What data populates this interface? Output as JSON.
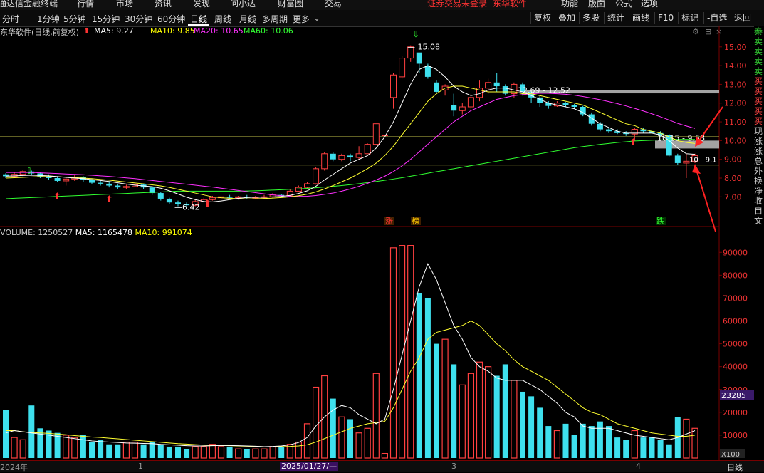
{
  "app": {
    "title_left": "通达信金融终端",
    "top_menu": [
      "行情",
      "市场",
      "资讯",
      "发现",
      "问小达",
      "财富圈",
      "交易"
    ],
    "top_menu_right": [
      "功能",
      "版面",
      "公式",
      "选项"
    ],
    "notice": "证券交易未登录",
    "notice_stock": "东华软件"
  },
  "tabs": [
    "分时",
    "1分钟",
    "5分钟",
    "15分钟",
    "30分钟",
    "60分钟",
    "日线",
    "周线",
    "月线",
    "多周期",
    "更多"
  ],
  "active_tab": "日线",
  "tools": [
    "复权",
    "叠加",
    "多股",
    "统计",
    "画线",
    "F10",
    "标记",
    "-自选",
    "返回"
  ],
  "stock": {
    "title": "东华软件(日线,前复权)",
    "ma5": "MA5: 9.27",
    "ma10": "MA10: 9.85",
    "ma20": "MA20: 10.65",
    "ma60": "MA60: 10.06"
  },
  "volume_info": {
    "volume": "VOLUME: 1250527",
    "ma5": "MA5: 1165478",
    "ma10": "MA10: 991074"
  },
  "annotations": {
    "high": "15.08",
    "low": "6.42",
    "zone1": "12.69 - 12.52",
    "zone2": "10.15 - 9.58",
    "zone3": "10 - 9.1",
    "zhang": "涨",
    "bang": "榜",
    "die": "跌",
    "vol_current": "23285",
    "vol_scale": "X100"
  },
  "colors": {
    "up": "#ff4040",
    "down": "#3ee0ee",
    "ma5": "#ffffff",
    "ma10": "#ffff30",
    "ma20": "#ff30ff",
    "ma60": "#30ff30",
    "grid": "#7a0000",
    "zone": "#c0c0c0"
  },
  "sidebar_text": [
    "秦",
    "卖",
    "卖",
    "卖",
    "卖",
    "买",
    "买",
    "买",
    "买",
    "买",
    "现",
    "涨",
    "涨",
    "总",
    "外",
    "换",
    "净",
    "收",
    "自",
    "文"
  ],
  "bottom": {
    "year_label": "2024年",
    "m1": "1",
    "date_label": "2025/01/27/—",
    "m3": "3",
    "m4": "4",
    "period": "日线"
  },
  "chart_data": {
    "type": "candlestick",
    "y_ticks": [
      15.0,
      14.0,
      13.0,
      12.0,
      11.0,
      10.0,
      9.0,
      8.0,
      7.0
    ],
    "ylim": [
      6.1,
      15.6
    ],
    "vol_ticks": [
      90000,
      80000,
      70000,
      60000,
      50000,
      40000,
      30000,
      20000,
      10000
    ],
    "vol_ylim": [
      0,
      96000
    ],
    "hlines": [
      10.2,
      8.7
    ],
    "candles": [
      [
        8.2,
        8.1,
        8.25,
        8.0
      ],
      [
        8.1,
        8.2,
        8.3,
        8.05
      ],
      [
        8.2,
        8.35,
        8.45,
        8.1
      ],
      [
        8.35,
        8.25,
        8.4,
        8.15
      ],
      [
        8.25,
        8.1,
        8.3,
        8.0
      ],
      [
        8.1,
        8.0,
        8.2,
        7.9
      ],
      [
        8.0,
        7.85,
        8.1,
        7.8
      ],
      [
        7.85,
        7.95,
        8.05,
        7.6
      ],
      [
        7.95,
        8.05,
        8.15,
        7.85
      ],
      [
        8.05,
        7.9,
        8.1,
        7.8
      ],
      [
        7.9,
        7.75,
        7.95,
        7.7
      ],
      [
        7.75,
        7.7,
        7.85,
        7.6
      ],
      [
        7.7,
        7.6,
        7.8,
        7.5
      ],
      [
        7.6,
        7.5,
        7.7,
        7.4
      ],
      [
        7.5,
        7.55,
        7.65,
        7.4
      ],
      [
        7.55,
        7.65,
        7.75,
        7.45
      ],
      [
        7.65,
        7.5,
        7.7,
        7.4
      ],
      [
        7.5,
        7.2,
        7.55,
        7.1
      ],
      [
        7.2,
        6.9,
        7.25,
        6.8
      ],
      [
        6.9,
        6.7,
        6.95,
        6.6
      ],
      [
        6.7,
        6.6,
        6.8,
        6.5
      ],
      [
        6.6,
        6.55,
        6.7,
        6.42
      ],
      [
        6.55,
        6.75,
        6.85,
        6.5
      ],
      [
        6.75,
        6.85,
        6.95,
        6.7
      ],
      [
        6.85,
        6.95,
        7.05,
        6.8
      ],
      [
        6.95,
        7.0,
        7.1,
        6.9
      ],
      [
        7.0,
        6.95,
        7.1,
        6.9
      ],
      [
        6.95,
        7.0,
        7.05,
        6.85
      ],
      [
        7.0,
        6.95,
        7.1,
        6.9
      ],
      [
        6.95,
        6.98,
        7.05,
        6.9
      ],
      [
        6.98,
        7.0,
        7.1,
        6.9
      ],
      [
        7.0,
        7.1,
        7.2,
        6.95
      ],
      [
        7.1,
        7.05,
        7.15,
        7.0
      ],
      [
        7.05,
        7.3,
        7.4,
        7.0
      ],
      [
        7.3,
        7.5,
        7.6,
        7.25
      ],
      [
        7.5,
        7.7,
        7.8,
        7.45
      ],
      [
        7.7,
        8.5,
        8.6,
        7.65
      ],
      [
        8.5,
        9.3,
        9.4,
        8.4
      ],
      [
        9.3,
        9.0,
        9.4,
        8.9
      ],
      [
        9.0,
        9.2,
        9.3,
        8.9
      ],
      [
        9.2,
        9.1,
        9.3,
        8.9
      ],
      [
        9.1,
        9.3,
        9.7,
        9.0
      ],
      [
        9.3,
        9.8,
        9.85,
        9.3
      ],
      [
        9.8,
        10.9,
        10.9,
        9.8
      ],
      [
        10.3,
        10.3,
        10.3,
        10.3
      ],
      [
        12.3,
        13.5,
        13.6,
        11.7
      ],
      [
        13.4,
        14.4,
        14.5,
        13.3
      ],
      [
        14.4,
        15.0,
        15.08,
        14.2
      ],
      [
        14.7,
        14.1,
        14.5,
        13.6
      ],
      [
        14.0,
        13.4,
        14.1,
        13.3
      ],
      [
        13.1,
        12.6,
        13.2,
        12.5
      ],
      [
        12.7,
        12.9,
        13.0,
        12.4
      ],
      [
        11.9,
        11.6,
        12.5,
        11.3
      ],
      [
        11.6,
        11.8,
        12.0,
        11.4
      ],
      [
        11.8,
        12.3,
        12.5,
        11.6
      ],
      [
        12.3,
        12.8,
        13.2,
        12.1
      ],
      [
        12.8,
        13.1,
        13.3,
        12.5
      ],
      [
        13.1,
        12.9,
        13.6,
        12.6
      ],
      [
        12.9,
        12.5,
        13.0,
        12.4
      ],
      [
        12.5,
        13.0,
        13.1,
        12.3
      ],
      [
        13.0,
        12.6,
        13.1,
        12.4
      ],
      [
        12.6,
        12.3,
        12.7,
        12.0
      ],
      [
        12.3,
        12.0,
        12.4,
        11.8
      ],
      [
        12.0,
        11.85,
        12.1,
        11.7
      ],
      [
        11.85,
        12.0,
        12.1,
        11.8
      ],
      [
        12.0,
        11.9,
        12.05,
        11.8
      ],
      [
        11.9,
        11.8,
        11.95,
        11.7
      ],
      [
        11.8,
        11.4,
        11.85,
        11.3
      ],
      [
        11.4,
        10.9,
        11.5,
        10.8
      ],
      [
        10.9,
        10.6,
        11.0,
        10.5
      ],
      [
        10.6,
        10.5,
        10.7,
        10.4
      ],
      [
        10.5,
        10.4,
        10.6,
        10.35
      ],
      [
        10.4,
        10.35,
        10.5,
        10.25
      ],
      [
        10.35,
        10.6,
        10.7,
        10.0
      ],
      [
        10.6,
        10.5,
        10.7,
        10.4
      ],
      [
        10.5,
        10.4,
        10.6,
        10.3
      ],
      [
        10.4,
        10.3,
        10.5,
        10.2
      ],
      [
        10.3,
        9.2,
        10.35,
        9.15
      ],
      [
        9.2,
        8.8,
        9.3,
        8.7
      ],
      [
        8.8,
        8.9,
        9.3,
        8.0
      ],
      [
        8.9,
        9.2,
        9.3,
        8.8
      ]
    ],
    "volumes": [
      21000,
      9000,
      8000,
      23000,
      13000,
      12000,
      11000,
      10000,
      9000,
      10000,
      7000,
      8000,
      6000,
      6000,
      7000,
      7000,
      6000,
      7000,
      6000,
      5000,
      5000,
      4000,
      5000,
      5000,
      6000,
      5000,
      5000,
      4000,
      4000,
      4000,
      4000,
      5000,
      5000,
      6000,
      7000,
      15000,
      31000,
      36000,
      26000,
      18000,
      17000,
      11000,
      13000,
      37000,
      2000,
      92000,
      93000,
      93000,
      72000,
      70000,
      50000,
      52000,
      41000,
      32000,
      37000,
      42000,
      40000,
      36000,
      41000,
      34000,
      29000,
      27000,
      22000,
      14000,
      12000,
      15000,
      10000,
      15000,
      14000,
      16000,
      14000,
      9000,
      8000,
      12000,
      9000,
      9000,
      8000,
      6000,
      18000,
      17000,
      13000
    ],
    "vol_ma5": [
      11000,
      12000,
      11500,
      11000,
      10500,
      10000,
      9500,
      9000,
      8500,
      8000,
      7500,
      7200,
      7000,
      6800,
      6600,
      6500,
      6400,
      6300,
      6000,
      5800,
      5600,
      5400,
      5300,
      5300,
      5400,
      5500,
      5500,
      5400,
      5300,
      5200,
      5000,
      5100,
      5300,
      5800,
      6800,
      9000,
      14000,
      18000,
      21000,
      23000,
      22000,
      19000,
      17000,
      15000,
      17000,
      30000,
      45000,
      60000,
      75000,
      85000,
      78000,
      68000,
      58000,
      52000,
      44000,
      40000,
      38000,
      35000,
      34000,
      34000,
      34000,
      32000,
      30000,
      27000,
      24000,
      20000,
      18000,
      14000,
      13000,
      13000,
      13000,
      12000,
      11000,
      10000,
      9500,
      9000,
      8500,
      8000,
      9000,
      10500,
      12000
    ],
    "vol_ma10": [
      12000,
      12000,
      11500,
      11200,
      11000,
      10800,
      10500,
      10200,
      9800,
      9500,
      9200,
      9000,
      8700,
      8400,
      8100,
      7800,
      7500,
      7200,
      6900,
      6600,
      6300,
      6100,
      5900,
      5700,
      5600,
      5500,
      5400,
      5300,
      5200,
      5100,
      5000,
      5000,
      5000,
      5100,
      5300,
      5800,
      7000,
      8500,
      10000,
      11500,
      13000,
      14000,
      15000,
      15500,
      16000,
      22000,
      30000,
      38000,
      44000,
      52000,
      55000,
      56000,
      57000,
      58000,
      60000,
      58000,
      54000,
      50000,
      47000,
      43000,
      40000,
      38000,
      36000,
      34000,
      31000,
      28000,
      25000,
      22000,
      20000,
      19000,
      17000,
      15000,
      14000,
      13000,
      12000,
      11000,
      10500,
      10000,
      9500,
      9500,
      10000
    ],
    "ma5": [
      8.1,
      8.12,
      8.14,
      8.15,
      8.14,
      8.12,
      8.08,
      8.04,
      8.0,
      7.97,
      7.92,
      7.87,
      7.82,
      7.75,
      7.68,
      7.62,
      7.58,
      7.54,
      7.46,
      7.32,
      7.15,
      6.98,
      6.85,
      6.75,
      6.73,
      6.78,
      6.85,
      6.92,
      6.96,
      6.98,
      6.98,
      7.0,
      7.02,
      7.08,
      7.18,
      7.32,
      7.56,
      7.9,
      8.2,
      8.5,
      8.8,
      9.0,
      9.2,
      9.6,
      10.2,
      11.0,
      12.0,
      13.0,
      13.8,
      14.0,
      13.8,
      13.4,
      12.9,
      12.6,
      12.4,
      12.5,
      12.7,
      12.8,
      12.8,
      12.7,
      12.6,
      12.4,
      12.2,
      12.0,
      11.9,
      11.8,
      11.7,
      11.5,
      11.2,
      10.9,
      10.7,
      10.5,
      10.4,
      10.4,
      10.4,
      10.4,
      10.3,
      10.0,
      9.6,
      9.3,
      9.27
    ],
    "ma10": [
      8.0,
      8.02,
      8.04,
      8.06,
      8.08,
      8.08,
      8.07,
      8.05,
      8.03,
      8.0,
      7.97,
      7.93,
      7.89,
      7.84,
      7.79,
      7.74,
      7.69,
      7.64,
      7.58,
      7.5,
      7.4,
      7.3,
      7.2,
      7.1,
      7.0,
      6.95,
      6.92,
      6.9,
      6.89,
      6.9,
      6.91,
      6.93,
      6.96,
      7.0,
      7.06,
      7.14,
      7.26,
      7.42,
      7.6,
      7.8,
      8.0,
      8.25,
      8.5,
      8.8,
      9.2,
      9.7,
      10.3,
      10.9,
      11.5,
      12.1,
      12.5,
      12.8,
      12.9,
      12.9,
      12.8,
      12.7,
      12.6,
      12.6,
      12.6,
      12.6,
      12.5,
      12.5,
      12.4,
      12.3,
      12.2,
      12.1,
      12.0,
      11.9,
      11.7,
      11.5,
      11.3,
      11.1,
      10.9,
      10.8,
      10.6,
      10.5,
      10.4,
      10.2,
      10.0,
      9.9,
      9.85
    ],
    "ma20": [
      8.3,
      8.3,
      8.3,
      8.3,
      8.28,
      8.26,
      8.24,
      8.22,
      8.2,
      8.18,
      8.15,
      8.12,
      8.09,
      8.05,
      8.01,
      7.97,
      7.92,
      7.87,
      7.82,
      7.77,
      7.72,
      7.67,
      7.62,
      7.57,
      7.52,
      7.46,
      7.4,
      7.34,
      7.28,
      7.22,
      7.16,
      7.1,
      7.06,
      7.03,
      7.02,
      7.03,
      7.07,
      7.13,
      7.2,
      7.3,
      7.42,
      7.56,
      7.72,
      7.9,
      8.1,
      8.35,
      8.65,
      9.0,
      9.4,
      9.8,
      10.2,
      10.6,
      11.0,
      11.3,
      11.6,
      11.8,
      12.0,
      12.2,
      12.3,
      12.4,
      12.45,
      12.5,
      12.52,
      12.52,
      12.5,
      12.47,
      12.42,
      12.35,
      12.27,
      12.18,
      12.08,
      11.97,
      11.85,
      11.72,
      11.58,
      11.43,
      11.27,
      11.1,
      10.92,
      10.78,
      10.65
    ],
    "ma60": [
      6.9,
      6.92,
      6.94,
      6.96,
      6.98,
      7.0,
      7.02,
      7.04,
      7.06,
      7.08,
      7.1,
      7.12,
      7.14,
      7.16,
      7.18,
      7.2,
      7.22,
      7.24,
      7.26,
      7.28,
      7.3,
      7.3,
      7.3,
      7.3,
      7.3,
      7.3,
      7.3,
      7.3,
      7.31,
      7.32,
      7.34,
      7.36,
      7.38,
      7.4,
      7.42,
      7.45,
      7.48,
      7.52,
      7.56,
      7.6,
      7.65,
      7.7,
      7.76,
      7.82,
      7.88,
      7.95,
      8.02,
      8.1,
      8.18,
      8.26,
      8.34,
      8.42,
      8.5,
      8.58,
      8.66,
      8.74,
      8.82,
      8.9,
      8.98,
      9.06,
      9.14,
      9.22,
      9.3,
      9.38,
      9.46,
      9.54,
      9.62,
      9.68,
      9.74,
      9.8,
      9.85,
      9.9,
      9.94,
      9.98,
      10.0,
      10.02,
      10.04,
      10.05,
      10.06,
      10.06,
      10.06
    ]
  }
}
